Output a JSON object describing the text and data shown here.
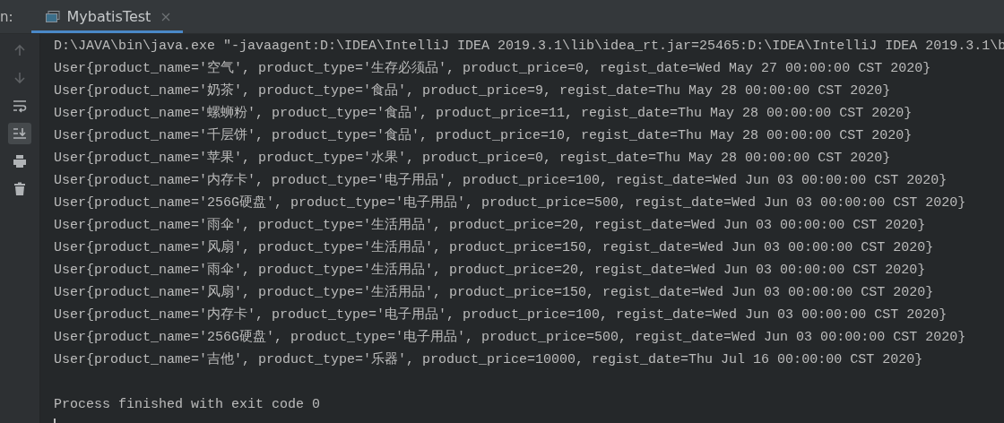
{
  "tool_window": {
    "label": "n:",
    "tab": {
      "title": "MybatisTest",
      "selected": true
    }
  },
  "toolbar": [
    {
      "kind": "up",
      "selected": false
    },
    {
      "kind": "down",
      "selected": false
    },
    {
      "kind": "wrap",
      "selected": false
    },
    {
      "kind": "scroll",
      "selected": true
    },
    {
      "kind": "print",
      "selected": false
    },
    {
      "kind": "trash",
      "selected": false
    }
  ],
  "console": {
    "command": "D:\\JAVA\\bin\\java.exe \"-javaagent:D:\\IDEA\\IntelliJ IDEA 2019.3.1\\lib\\idea_rt.jar=25465:D:\\IDEA\\IntelliJ IDEA 2019.3.1\\b",
    "lines": [
      "User{product_name='空气', product_type='生存必须品', product_price=0, regist_date=Wed May 27 00:00:00 CST 2020}",
      "User{product_name='奶茶', product_type='食品', product_price=9, regist_date=Thu May 28 00:00:00 CST 2020}",
      "User{product_name='螺蛳粉', product_type='食品', product_price=11, regist_date=Thu May 28 00:00:00 CST 2020}",
      "User{product_name='千层饼', product_type='食品', product_price=10, regist_date=Thu May 28 00:00:00 CST 2020}",
      "User{product_name='苹果', product_type='水果', product_price=0, regist_date=Thu May 28 00:00:00 CST 2020}",
      "User{product_name='内存卡', product_type='电子用品', product_price=100, regist_date=Wed Jun 03 00:00:00 CST 2020}",
      "User{product_name='256G硬盘', product_type='电子用品', product_price=500, regist_date=Wed Jun 03 00:00:00 CST 2020}",
      "User{product_name='雨伞', product_type='生活用品', product_price=20, regist_date=Wed Jun 03 00:00:00 CST 2020}",
      "User{product_name='风扇', product_type='生活用品', product_price=150, regist_date=Wed Jun 03 00:00:00 CST 2020}",
      "User{product_name='雨伞', product_type='生活用品', product_price=20, regist_date=Wed Jun 03 00:00:00 CST 2020}",
      "User{product_name='风扇', product_type='生活用品', product_price=150, regist_date=Wed Jun 03 00:00:00 CST 2020}",
      "User{product_name='内存卡', product_type='电子用品', product_price=100, regist_date=Wed Jun 03 00:00:00 CST 2020}",
      "User{product_name='256G硬盘', product_type='电子用品', product_price=500, regist_date=Wed Jun 03 00:00:00 CST 2020}",
      "User{product_name='吉他', product_type='乐器', product_price=10000, regist_date=Thu Jul 16 00:00:00 CST 2020}"
    ],
    "exit_message": "Process finished with exit code 0"
  }
}
